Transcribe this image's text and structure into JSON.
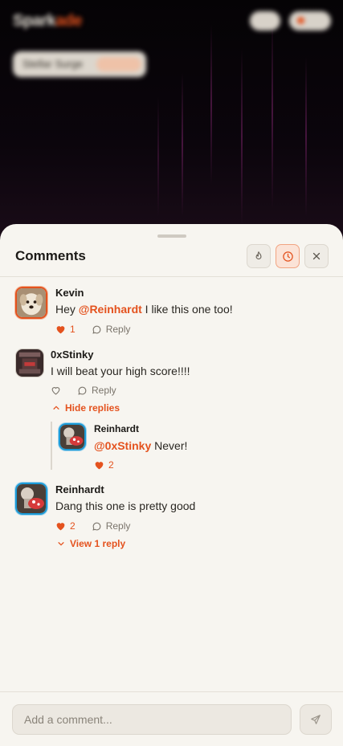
{
  "app": {
    "logo_main": "Spark",
    "logo_accent": "ade"
  },
  "background": {
    "chip_label": "Stellar Surge"
  },
  "panel": {
    "title": "Comments"
  },
  "colors": {
    "accent": "#e4521e",
    "blue_ring": "#1b9ad6",
    "sheet_bg": "#f7f5f0"
  },
  "comments": [
    {
      "username": "Kevin",
      "avatar": "dog-avatar",
      "prefix": "Hey ",
      "mention": "@Reinhardt",
      "suffix": " I like this one too!",
      "likes": "1",
      "reply_label": "Reply"
    },
    {
      "username": "0xStinky",
      "avatar": "pixel-avatar",
      "text": "I will beat your high score!!!!",
      "reply_label": "Reply",
      "toggle_label": "Hide replies",
      "replies": [
        {
          "username": "Reinhardt",
          "avatar": "mushroom-avatar",
          "mention": "@0xStinky",
          "suffix": " Never!",
          "likes": "2"
        }
      ]
    },
    {
      "username": "Reinhardt",
      "avatar": "mushroom-avatar",
      "text": "Dang this one is pretty good",
      "likes": "2",
      "reply_label": "Reply",
      "toggle_label": "View 1 reply"
    }
  ],
  "composer": {
    "placeholder": "Add a comment..."
  }
}
